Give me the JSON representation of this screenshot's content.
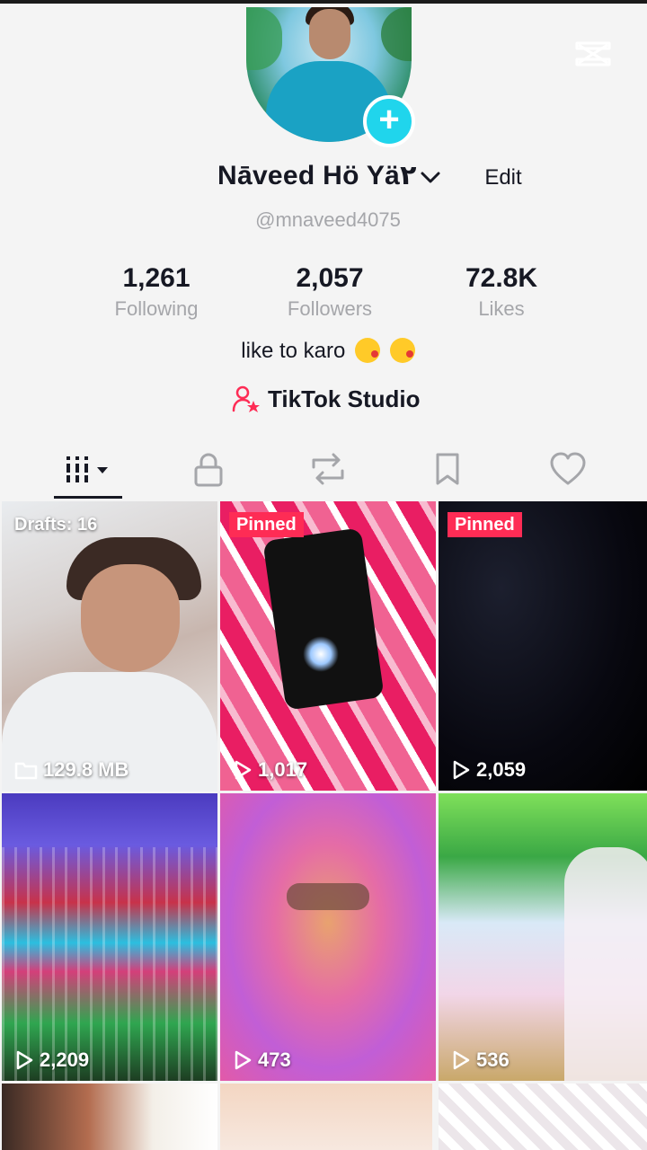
{
  "profile": {
    "display_name": "Nāveed Hö Yä٢",
    "username": "@mnaveed4075",
    "edit_label": "Edit",
    "bio": "like to karo",
    "studio_label": "TikTok Studio"
  },
  "stats": [
    {
      "value": "1,261",
      "label": "Following"
    },
    {
      "value": "2,057",
      "label": "Followers"
    },
    {
      "value": "72.8K",
      "label": "Likes"
    }
  ],
  "tabs": [
    {
      "name": "videos-grid-tab",
      "icon": "grid-icon",
      "active": true
    },
    {
      "name": "private-tab",
      "icon": "lock-icon"
    },
    {
      "name": "reposts-tab",
      "icon": "repost-icon"
    },
    {
      "name": "favorites-tab",
      "icon": "bookmark-icon"
    },
    {
      "name": "liked-tab",
      "icon": "heart-icon"
    }
  ],
  "grid": [
    {
      "badge": "Drafts: 16",
      "badge_type": "drafts",
      "meta": "129.8 MB",
      "meta_icon": "folder-icon"
    },
    {
      "badge": "Pinned",
      "badge_type": "pinned",
      "meta": "1,017",
      "meta_icon": "play-icon"
    },
    {
      "badge": "Pinned",
      "badge_type": "pinned",
      "meta": "2,059",
      "meta_icon": "play-icon"
    },
    {
      "badge": "",
      "meta": "2,209",
      "meta_icon": "play-icon"
    },
    {
      "badge": "",
      "meta": "473",
      "meta_icon": "play-icon"
    },
    {
      "badge": "",
      "meta": "536",
      "meta_icon": "play-icon"
    },
    {
      "badge": "",
      "meta": ""
    },
    {
      "badge": "",
      "meta": ""
    },
    {
      "badge": "",
      "meta": ""
    }
  ],
  "colors": {
    "accent_cyan": "#20d5ec",
    "pinned_red": "#fe2c55",
    "text_primary": "#161823",
    "text_secondary": "#a5a6aa"
  }
}
